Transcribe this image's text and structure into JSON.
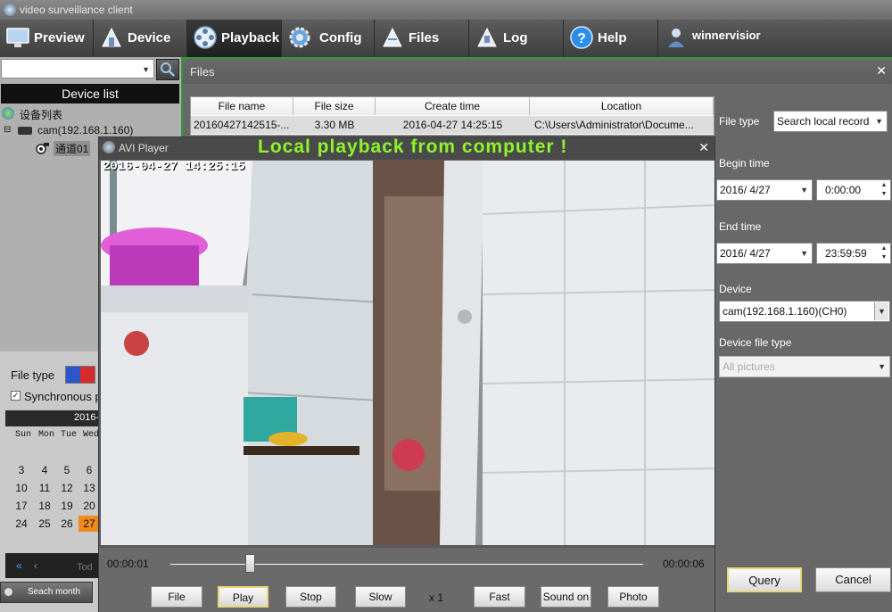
{
  "window": {
    "title": "video surveillance client"
  },
  "menu": {
    "items": [
      {
        "label": "Preview",
        "icon": "monitor-icon"
      },
      {
        "label": "Device",
        "icon": "device-icon"
      },
      {
        "label": "Playback",
        "icon": "film-reel-icon"
      },
      {
        "label": "Config",
        "icon": "gear-icon"
      },
      {
        "label": "Files",
        "icon": "files-icon"
      },
      {
        "label": "Log",
        "icon": "log-icon"
      },
      {
        "label": "Help",
        "icon": "help-icon"
      }
    ],
    "user": "winnervisior"
  },
  "left": {
    "device_list_title": "Device list",
    "tree": {
      "root": "设备列表",
      "device": "cam(192.168.1.160)",
      "channel": "通道01"
    }
  },
  "files": {
    "title": "Files",
    "columns": [
      "File name",
      "File size",
      "Create time",
      "Location"
    ],
    "rows": [
      {
        "name": "20160427142515-...",
        "size": "3.30 MB",
        "time": "2016-04-27 14:25:15",
        "location": "C:\\Users\\Administrator\\Docume..."
      }
    ]
  },
  "search": {
    "file_type_label": "File type",
    "file_type_value": "Search local record",
    "begin_label": "Begin time",
    "begin_date": "2016/  4/27",
    "begin_time": "0:00:00",
    "end_label": "End time",
    "end_date": "2016/  4/27",
    "end_time": "23:59:59",
    "device_label": "Device",
    "device_value": "cam(192.168.1.160)(CH0)",
    "device_file_type_label": "Device file type",
    "device_file_type_value": "All pictures",
    "query_label": "Query",
    "cancel_label": "Cancel"
  },
  "bottom_left": {
    "file_type_label": "File type",
    "sync_label": "Synchronous p",
    "month_label": "2016-",
    "weekdays": [
      "Sun",
      "Mon",
      "Tue",
      "Wed"
    ],
    "weeks": [
      [
        "3",
        "4",
        "5",
        "6"
      ],
      [
        "10",
        "11",
        "12",
        "13"
      ],
      [
        "17",
        "18",
        "19",
        "20"
      ],
      [
        "24",
        "25",
        "26",
        "27"
      ]
    ],
    "today_label": "Tod",
    "search_month_label": "Seach month"
  },
  "player": {
    "title": "AVI Player",
    "banner": "Local  playback  from  computer !",
    "timestamp": "2016-04-27 14:25:15",
    "current_time": "00:00:01",
    "total_time": "00:00:06",
    "progress": 0.17,
    "buttons": {
      "file": "File",
      "play": "Play",
      "stop": "Stop",
      "slow": "Slow",
      "speed": "x 1",
      "fast": "Fast",
      "sound": "Sound on",
      "photo": "Photo"
    }
  },
  "colors": {
    "accent_green": "#2e9c3a",
    "banner_green": "#8df52a",
    "highlight_day": "#f08a1e"
  }
}
